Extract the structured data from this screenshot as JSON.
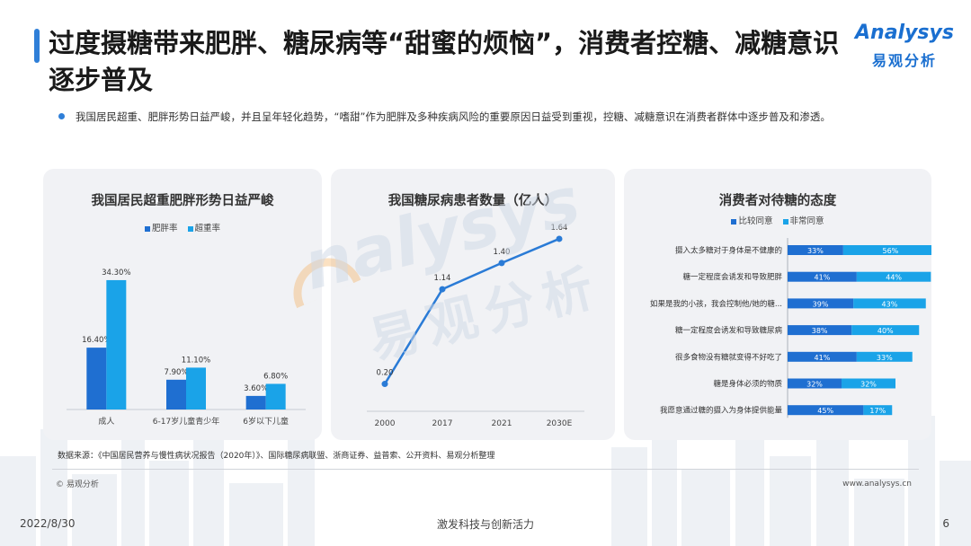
{
  "header": {
    "title": "过度摄糖带来肥胖、糖尿病等“甜蜜的烦恼”，消费者控糖、减糖意识逐步普及",
    "brand_en": "Analysys",
    "brand_cn": "易观分析"
  },
  "bullet": "我国居民超重、肥胖形势日益严峻，并且呈年轻化趋势，“嗜甜”作为肥胖及多种疾病风险的重要原因日益受到重视，控糖、减糖意识在消费者群体中逐步普及和渗透。",
  "colors": {
    "dark_blue": "#1f6fd1",
    "light_blue": "#1aa3e8",
    "line_blue": "#2a7bd6",
    "accent": "#2f7fd8"
  },
  "chart_data": [
    {
      "type": "bar",
      "title": "我国居民超重肥胖形势日益严峻",
      "categories": [
        "成人",
        "6-17岁儿童青少年",
        "6岁以下儿童"
      ],
      "series": [
        {
          "name": "肥胖率",
          "values": [
            16.4,
            7.9,
            3.6
          ],
          "labels": [
            "16.40%",
            "7.90%",
            "3.60%"
          ]
        },
        {
          "name": "超重率",
          "values": [
            34.3,
            11.1,
            6.8
          ],
          "labels": [
            "34.30%",
            "11.10%",
            "6.80%"
          ]
        }
      ],
      "ylim": [
        0,
        40
      ],
      "grid": false,
      "legend": "top-center"
    },
    {
      "type": "line",
      "title": "我国糖尿病患者数量（亿人）",
      "x": [
        "2000",
        "2017",
        "2021",
        "2030E"
      ],
      "values": [
        0.2,
        1.14,
        1.4,
        1.64
      ],
      "labels": [
        "0.20",
        "1.14",
        "1.40",
        "1.64"
      ],
      "ylim": [
        0,
        1.8
      ],
      "grid": false
    },
    {
      "type": "bar",
      "orientation": "horizontal-stacked",
      "title": "消费者对待糖的态度",
      "categories": [
        "摄入太多糖对于身体是不健康的",
        "糖一定程度会诱发和导致肥胖",
        "如果是我的小孩，我会控制他/她的糖...",
        "糖一定程度会诱发和导致糖尿病",
        "很多食物没有糖就变得不好吃了",
        "糖是身体必须的物质",
        "我愿意通过糖的摄入为身体提供能量"
      ],
      "series": [
        {
          "name": "比较同意",
          "values": [
            33,
            41,
            39,
            38,
            41,
            32,
            45
          ],
          "labels": [
            "33%",
            "41%",
            "39%",
            "38%",
            "41%",
            "32%",
            "45%"
          ]
        },
        {
          "name": "非常同意",
          "values": [
            56,
            44,
            43,
            40,
            33,
            32,
            17
          ],
          "labels": [
            "56%",
            "44%",
            "43%",
            "40%",
            "33%",
            "32%",
            "17%"
          ]
        }
      ],
      "xlim": [
        0,
        100
      ],
      "grid": false,
      "legend": "top-center"
    }
  ],
  "watermark": {
    "en": "nalysys",
    "cn": "易观分析"
  },
  "footer": {
    "source": "数据来源：《中国居民营养与慢性病状况报告（2020年）》、国际糖尿病联盟、浙商证券、益普索、公开资料、易观分析整理",
    "copyright": "© 易观分析",
    "website": "www.analysys.cn",
    "date": "2022/8/30",
    "slogan": "激发科技与创新活力",
    "page": "6"
  }
}
